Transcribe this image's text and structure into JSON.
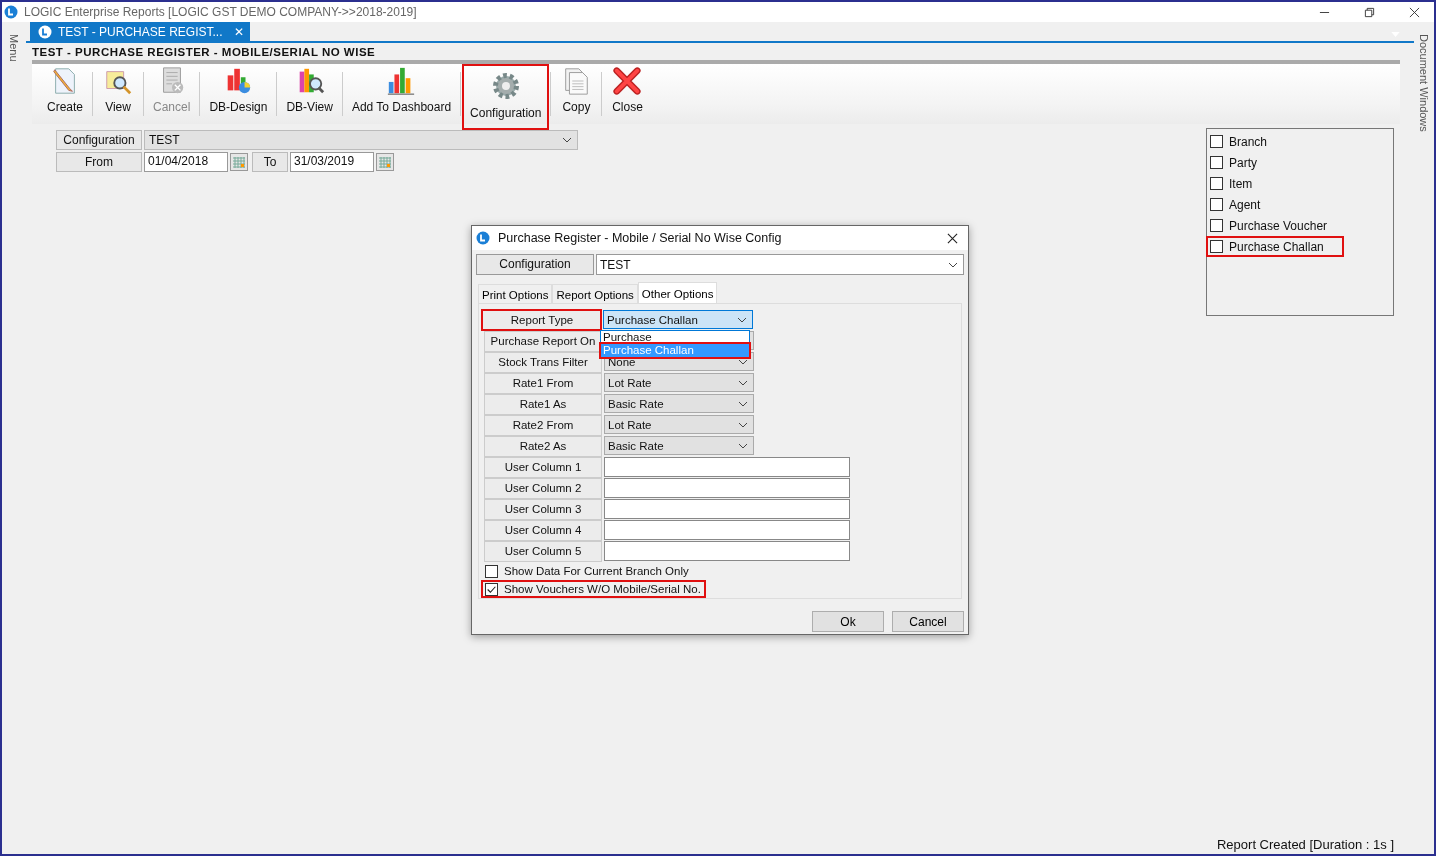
{
  "window": {
    "title": "LOGIC Enterprise Reports  [LOGIC GST DEMO COMPANY->>2018-2019]"
  },
  "side_panels": {
    "left": "Menu",
    "right": "Document Windows"
  },
  "document_tab": {
    "label": "TEST - PURCHASE REGIST...",
    "close": "✕"
  },
  "report_title": "TEST - PURCHASE REGISTER - MOBILE/SERIAL NO WISE",
  "toolbar": [
    {
      "label": "Create",
      "kind": "create",
      "disabled": false,
      "highlighted": false
    },
    {
      "label": "View",
      "kind": "view",
      "disabled": false,
      "highlighted": false
    },
    {
      "label": "Cancel",
      "kind": "cancel",
      "disabled": true,
      "highlighted": false
    },
    {
      "label": "DB-Design",
      "kind": "dbdesign",
      "disabled": false,
      "highlighted": false
    },
    {
      "label": "DB-View",
      "kind": "dbview",
      "disabled": false,
      "highlighted": false
    },
    {
      "label": "Add To Dashboard",
      "kind": "dashboard",
      "disabled": false,
      "highlighted": false
    },
    {
      "label": "Configuration",
      "kind": "config",
      "disabled": false,
      "highlighted": true
    },
    {
      "label": "Copy",
      "kind": "copy",
      "disabled": false,
      "highlighted": false
    },
    {
      "label": "Close",
      "kind": "close",
      "disabled": false,
      "highlighted": false
    }
  ],
  "filters": {
    "configuration_label": "Configuration",
    "configuration_value": "TEST",
    "from_label": "From",
    "from_value": "01/04/2018",
    "to_label": "To",
    "to_value": "31/03/2019"
  },
  "group_options": [
    {
      "label": "Branch",
      "checked": false,
      "highlighted": false
    },
    {
      "label": "Party",
      "checked": false,
      "highlighted": false
    },
    {
      "label": "Item",
      "checked": false,
      "highlighted": false
    },
    {
      "label": "Agent",
      "checked": false,
      "highlighted": false
    },
    {
      "label": "Purchase Voucher",
      "checked": false,
      "highlighted": false
    },
    {
      "label": "Purchase Challan",
      "checked": false,
      "highlighted": true
    }
  ],
  "dialog": {
    "title": "Purchase Register - Mobile / Serial No Wise Config",
    "configuration_label": "Configuration",
    "configuration_value": "TEST",
    "tabs": [
      {
        "label": "Print Options",
        "selected": false
      },
      {
        "label": "Report Options",
        "selected": false
      },
      {
        "label": "Other Options",
        "selected": true
      }
    ],
    "rows": [
      {
        "label": "Report Type",
        "kind": "select",
        "value": "Purchase Challan",
        "focused": true,
        "highlighted": true
      },
      {
        "label": "Purchase Report On",
        "kind": "select",
        "focused": false,
        "highlighted": false
      },
      {
        "label": "Stock Trans Filter",
        "kind": "select",
        "value": "None",
        "focused": false,
        "highlighted": false
      },
      {
        "label": "Rate1 From",
        "kind": "select",
        "value": "Lot Rate",
        "focused": false,
        "highlighted": false
      },
      {
        "label": "Rate1 As",
        "kind": "select",
        "value": "Basic Rate",
        "focused": false,
        "highlighted": false
      },
      {
        "label": "Rate2 From",
        "kind": "select",
        "value": "Lot Rate",
        "focused": false,
        "highlighted": false
      },
      {
        "label": "Rate2 As",
        "kind": "select",
        "value": "Basic Rate",
        "focused": false,
        "highlighted": false
      },
      {
        "label": "User Column 1",
        "kind": "text",
        "value": "",
        "focused": false,
        "highlighted": false
      },
      {
        "label": "User Column 2",
        "kind": "text",
        "value": "",
        "focused": false,
        "highlighted": false
      },
      {
        "label": "User Column 3",
        "kind": "text",
        "value": "",
        "focused": false,
        "highlighted": false
      },
      {
        "label": "User Column 4",
        "kind": "text",
        "value": "",
        "focused": false,
        "highlighted": false
      },
      {
        "label": "User Column 5",
        "kind": "text",
        "value": "",
        "focused": false,
        "highlighted": false
      }
    ],
    "dropdown_options": [
      {
        "label": "Purchase",
        "selected": false,
        "highlighted": false
      },
      {
        "label": "Purchase Challan",
        "selected": true,
        "highlighted": true
      }
    ],
    "checkboxes": [
      {
        "label": "Show Data For Current Branch Only",
        "checked": false,
        "highlighted": false
      },
      {
        "label": "Show Vouchers W/O Mobile/Serial No.",
        "checked": true,
        "highlighted": true
      }
    ],
    "buttons": [
      "Ok",
      "Cancel"
    ]
  },
  "status_bar": "Report Created [Duration : 1s ]"
}
